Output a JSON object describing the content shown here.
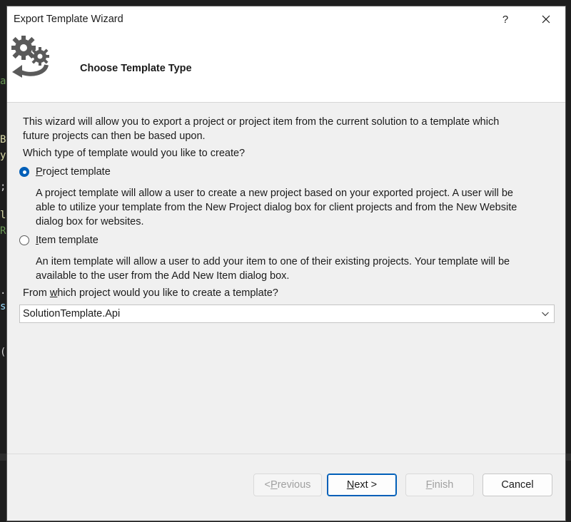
{
  "window": {
    "title": "Export Template Wizard",
    "help_glyph": "?",
    "close_glyph": "✕"
  },
  "header": {
    "title": "Choose Template Type",
    "icon": "gears-arrow-icon"
  },
  "intro": {
    "line1": "This wizard will allow you to export a project or project item from the current solution to a template which",
    "line2": "future projects can then be based upon.",
    "question": "Which type of template would you like to create?"
  },
  "options": {
    "project": {
      "label_mnemonic": "P",
      "label_rest": "roject template",
      "selected": true,
      "desc1": "A project template will allow a user to create a new project based on your exported project. A user will be",
      "desc2": "able to utilize your template from the New Project dialog box for client projects and from the New Website",
      "desc3": "dialog box for websites."
    },
    "item": {
      "label_mnemonic": "I",
      "label_rest": "tem template",
      "selected": false,
      "desc1": "An item template will allow a user to add your item to one of their existing projects. Your template will be",
      "desc2": "available to the user from the Add New Item dialog box."
    }
  },
  "project_select": {
    "question_pre": "From ",
    "question_mnemonic": "w",
    "question_post": "hich project would you like to create a template?",
    "selected_value": "SolutionTemplate.Api"
  },
  "buttons": {
    "previous": {
      "pre": "< ",
      "mnemonic": "P",
      "post": "revious",
      "enabled": false
    },
    "next": {
      "mnemonic": "N",
      "post": "ext >",
      "enabled": true
    },
    "finish": {
      "mnemonic": "F",
      "post": "inish",
      "enabled": false
    },
    "cancel": {
      "label": "Cancel",
      "enabled": true
    }
  },
  "background": {
    "chars": [
      {
        "text": "a",
        "color": "#6a9955"
      },
      {
        "text": "B",
        "color": "#dcdcaa"
      },
      {
        "text": "y",
        "color": "#dcdcaa"
      },
      {
        "text": ";",
        "color": "#d4d4d4"
      },
      {
        "text": "l",
        "color": "#dcdcaa"
      },
      {
        "text": "R",
        "color": "#6a9955"
      },
      {
        "text": ".",
        "color": "#d4d4d4"
      },
      {
        "text": "s",
        "color": "#9cdcfe"
      },
      {
        "text": "(",
        "color": "#d4d4d4"
      }
    ]
  },
  "colors": {
    "accent": "#005fb8",
    "dialog_bg": "#f0f0f0",
    "header_bg": "#ffffff"
  }
}
